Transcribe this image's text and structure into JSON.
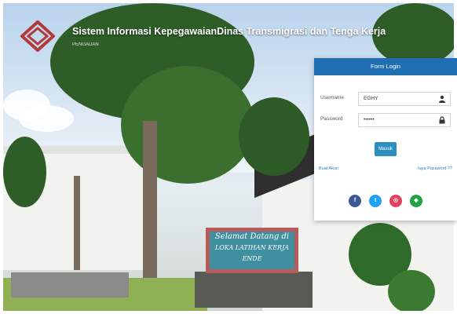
{
  "header": {
    "title": "Sistem Informasi KepegawaianDinas Transmigrasi dan Tenga Kerja",
    "subtitle": "PENGADAN"
  },
  "signboard": {
    "line1": "Selamat Datang di",
    "line2": "LOKA LATIHAN KERJA",
    "line3": "ENDE"
  },
  "login": {
    "title": "Form Login",
    "username_label": "Username",
    "username_value": "EGHY",
    "password_label": "Password",
    "password_value": "••••••",
    "submit_label": "Masuk",
    "register_link": "Buat Akun",
    "forgot_link": "lupa Password ??"
  },
  "social": [
    {
      "name": "facebook-icon",
      "glyph": "f",
      "color": "#3b5998"
    },
    {
      "name": "twitter-icon",
      "glyph": "t",
      "color": "#1da1f2"
    },
    {
      "name": "instagram-icon",
      "glyph": "◎",
      "color": "#e4405f"
    },
    {
      "name": "googleplus-icon",
      "glyph": "◆",
      "color": "#25a244"
    }
  ],
  "colors": {
    "brand_primary": "#1f6fb2",
    "logo_red": "#b23a3a"
  }
}
